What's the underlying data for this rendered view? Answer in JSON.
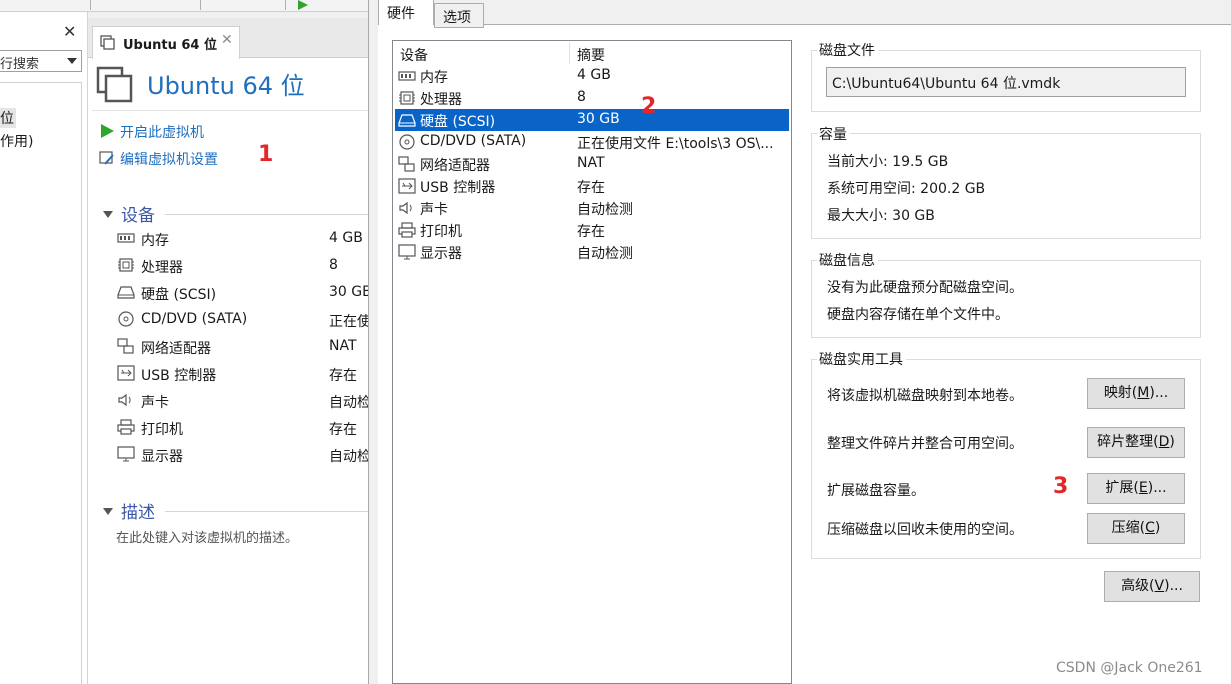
{
  "library": {
    "search_text": "在此处键入内容进行搜索",
    "search_text_visible": "行搜索",
    "items": [
      "位",
      "作用)"
    ]
  },
  "vm_tab": {
    "label": "Ubuntu 64 位"
  },
  "vm": {
    "title": "Ubuntu 64 位",
    "actions": {
      "power_on": "开启此虚拟机",
      "edit_settings": "编辑虚拟机设置"
    },
    "devices_heading": "设备",
    "devices": [
      {
        "name": "内存",
        "value": "4 GB",
        "icon": "memory-icon"
      },
      {
        "name": "处理器",
        "value": "8",
        "icon": "cpu-icon"
      },
      {
        "name": "硬盘 (SCSI)",
        "value": "30 GB",
        "icon": "hard-disk-icon"
      },
      {
        "name": "CD/DVD (SATA)",
        "value": "正在使",
        "icon": "cd-dvd-icon"
      },
      {
        "name": "网络适配器",
        "value": "NAT",
        "icon": "network-adapter-icon"
      },
      {
        "name": "USB 控制器",
        "value": "存在",
        "icon": "usb-icon"
      },
      {
        "name": "声卡",
        "value": "自动检",
        "icon": "sound-card-icon"
      },
      {
        "name": "打印机",
        "value": "存在",
        "icon": "printer-icon"
      },
      {
        "name": "显示器",
        "value": "自动检",
        "icon": "display-icon"
      }
    ],
    "description_heading": "描述",
    "description_placeholder": "在此处键入对该虚拟机的描述。"
  },
  "annotations": {
    "step1": "1",
    "step2": "2",
    "step3": "3"
  },
  "dialog": {
    "tabs": [
      "硬件",
      "选项"
    ],
    "list_headers": {
      "device": "设备",
      "summary": "摘要"
    },
    "hardware": [
      {
        "name": "内存",
        "summary": "4 GB"
      },
      {
        "name": "处理器",
        "summary": "8"
      },
      {
        "name": "硬盘 (SCSI)",
        "summary": "30 GB"
      },
      {
        "name": "CD/DVD (SATA)",
        "summary": "正在使用文件 E:\\tools\\3 OS\\..."
      },
      {
        "name": "网络适配器",
        "summary": "NAT"
      },
      {
        "name": "USB 控制器",
        "summary": "存在"
      },
      {
        "name": "声卡",
        "summary": "自动检测"
      },
      {
        "name": "打印机",
        "summary": "存在"
      },
      {
        "name": "显示器",
        "summary": "自动检测"
      }
    ],
    "selected_hardware": "硬盘 (SCSI)",
    "disk_file": {
      "title": "磁盘文件",
      "value": "C:\\Ubuntu64\\Ubuntu 64 位.vmdk"
    },
    "capacity": {
      "title": "容量",
      "current": "当前大小: 19.5 GB",
      "available": "系统可用空间: 200.2 GB",
      "max": "最大大小: 30 GB"
    },
    "disk_info": {
      "title": "磁盘信息",
      "line1": "没有为此硬盘预分配磁盘空间。",
      "line2": "硬盘内容存储在单个文件中。"
    },
    "utilities": {
      "title": "磁盘实用工具",
      "map_text": "将该虚拟机磁盘映射到本地卷。",
      "map_button": {
        "label": "映射(",
        "key": "M",
        "suffix": ")..."
      },
      "defrag_text": "整理文件碎片并整合可用空间。",
      "defrag_button": {
        "label": "碎片整理(",
        "key": "D",
        "suffix": ")"
      },
      "expand_text": "扩展磁盘容量。",
      "expand_button": {
        "label": "扩展(",
        "key": "E",
        "suffix": ")..."
      },
      "compact_text": "压缩磁盘以回收未使用的空间。",
      "compact_button": {
        "label": "压缩(",
        "key": "C",
        "suffix": ")"
      }
    },
    "advanced_button": {
      "label": "高级(",
      "key": "V",
      "suffix": ")..."
    }
  },
  "watermark": "CSDN @Jack One261",
  "colors": {
    "accent": "#1f6fbf",
    "selection": "#0a64c8",
    "annotation": "#e3262b",
    "section_heading": "#3b57a8"
  }
}
